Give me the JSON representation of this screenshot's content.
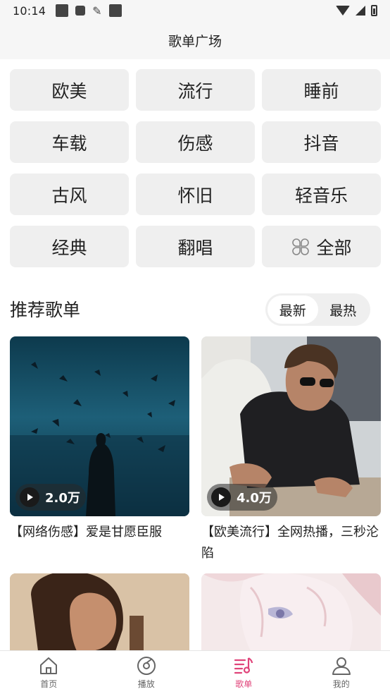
{
  "status_bar": {
    "time": "10:14"
  },
  "header": {
    "title": "歌单广场"
  },
  "categories": [
    {
      "label": "欧美"
    },
    {
      "label": "流行"
    },
    {
      "label": "睡前"
    },
    {
      "label": "车载"
    },
    {
      "label": "伤感"
    },
    {
      "label": "抖音"
    },
    {
      "label": "古风"
    },
    {
      "label": "怀旧"
    },
    {
      "label": "轻音乐"
    },
    {
      "label": "经典"
    },
    {
      "label": "翻唱"
    },
    {
      "label": "全部",
      "icon": "grid-icon"
    }
  ],
  "recommend": {
    "title": "推荐歌单",
    "sort_options": [
      {
        "label": "最新",
        "active": true
      },
      {
        "label": "最热",
        "active": false
      }
    ]
  },
  "playlists": [
    {
      "title": "【网络伤感】爱是甘愿臣服",
      "play_count": "2.0万"
    },
    {
      "title": "【欧美流行】全网热播，三秒沦陷",
      "play_count": "4.0万"
    },
    {
      "title": "",
      "play_count": ""
    },
    {
      "title": "",
      "play_count": ""
    }
  ],
  "tabbar": {
    "items": [
      {
        "label": "首页",
        "icon": "home-icon"
      },
      {
        "label": "播放",
        "icon": "disc-icon"
      },
      {
        "label": "歌单",
        "icon": "playlist-icon",
        "active": true
      },
      {
        "label": "我的",
        "icon": "person-icon"
      }
    ]
  },
  "colors": {
    "accent": "#e0447a",
    "chip_bg": "#efefef",
    "header_bg": "#f6f6f6"
  }
}
